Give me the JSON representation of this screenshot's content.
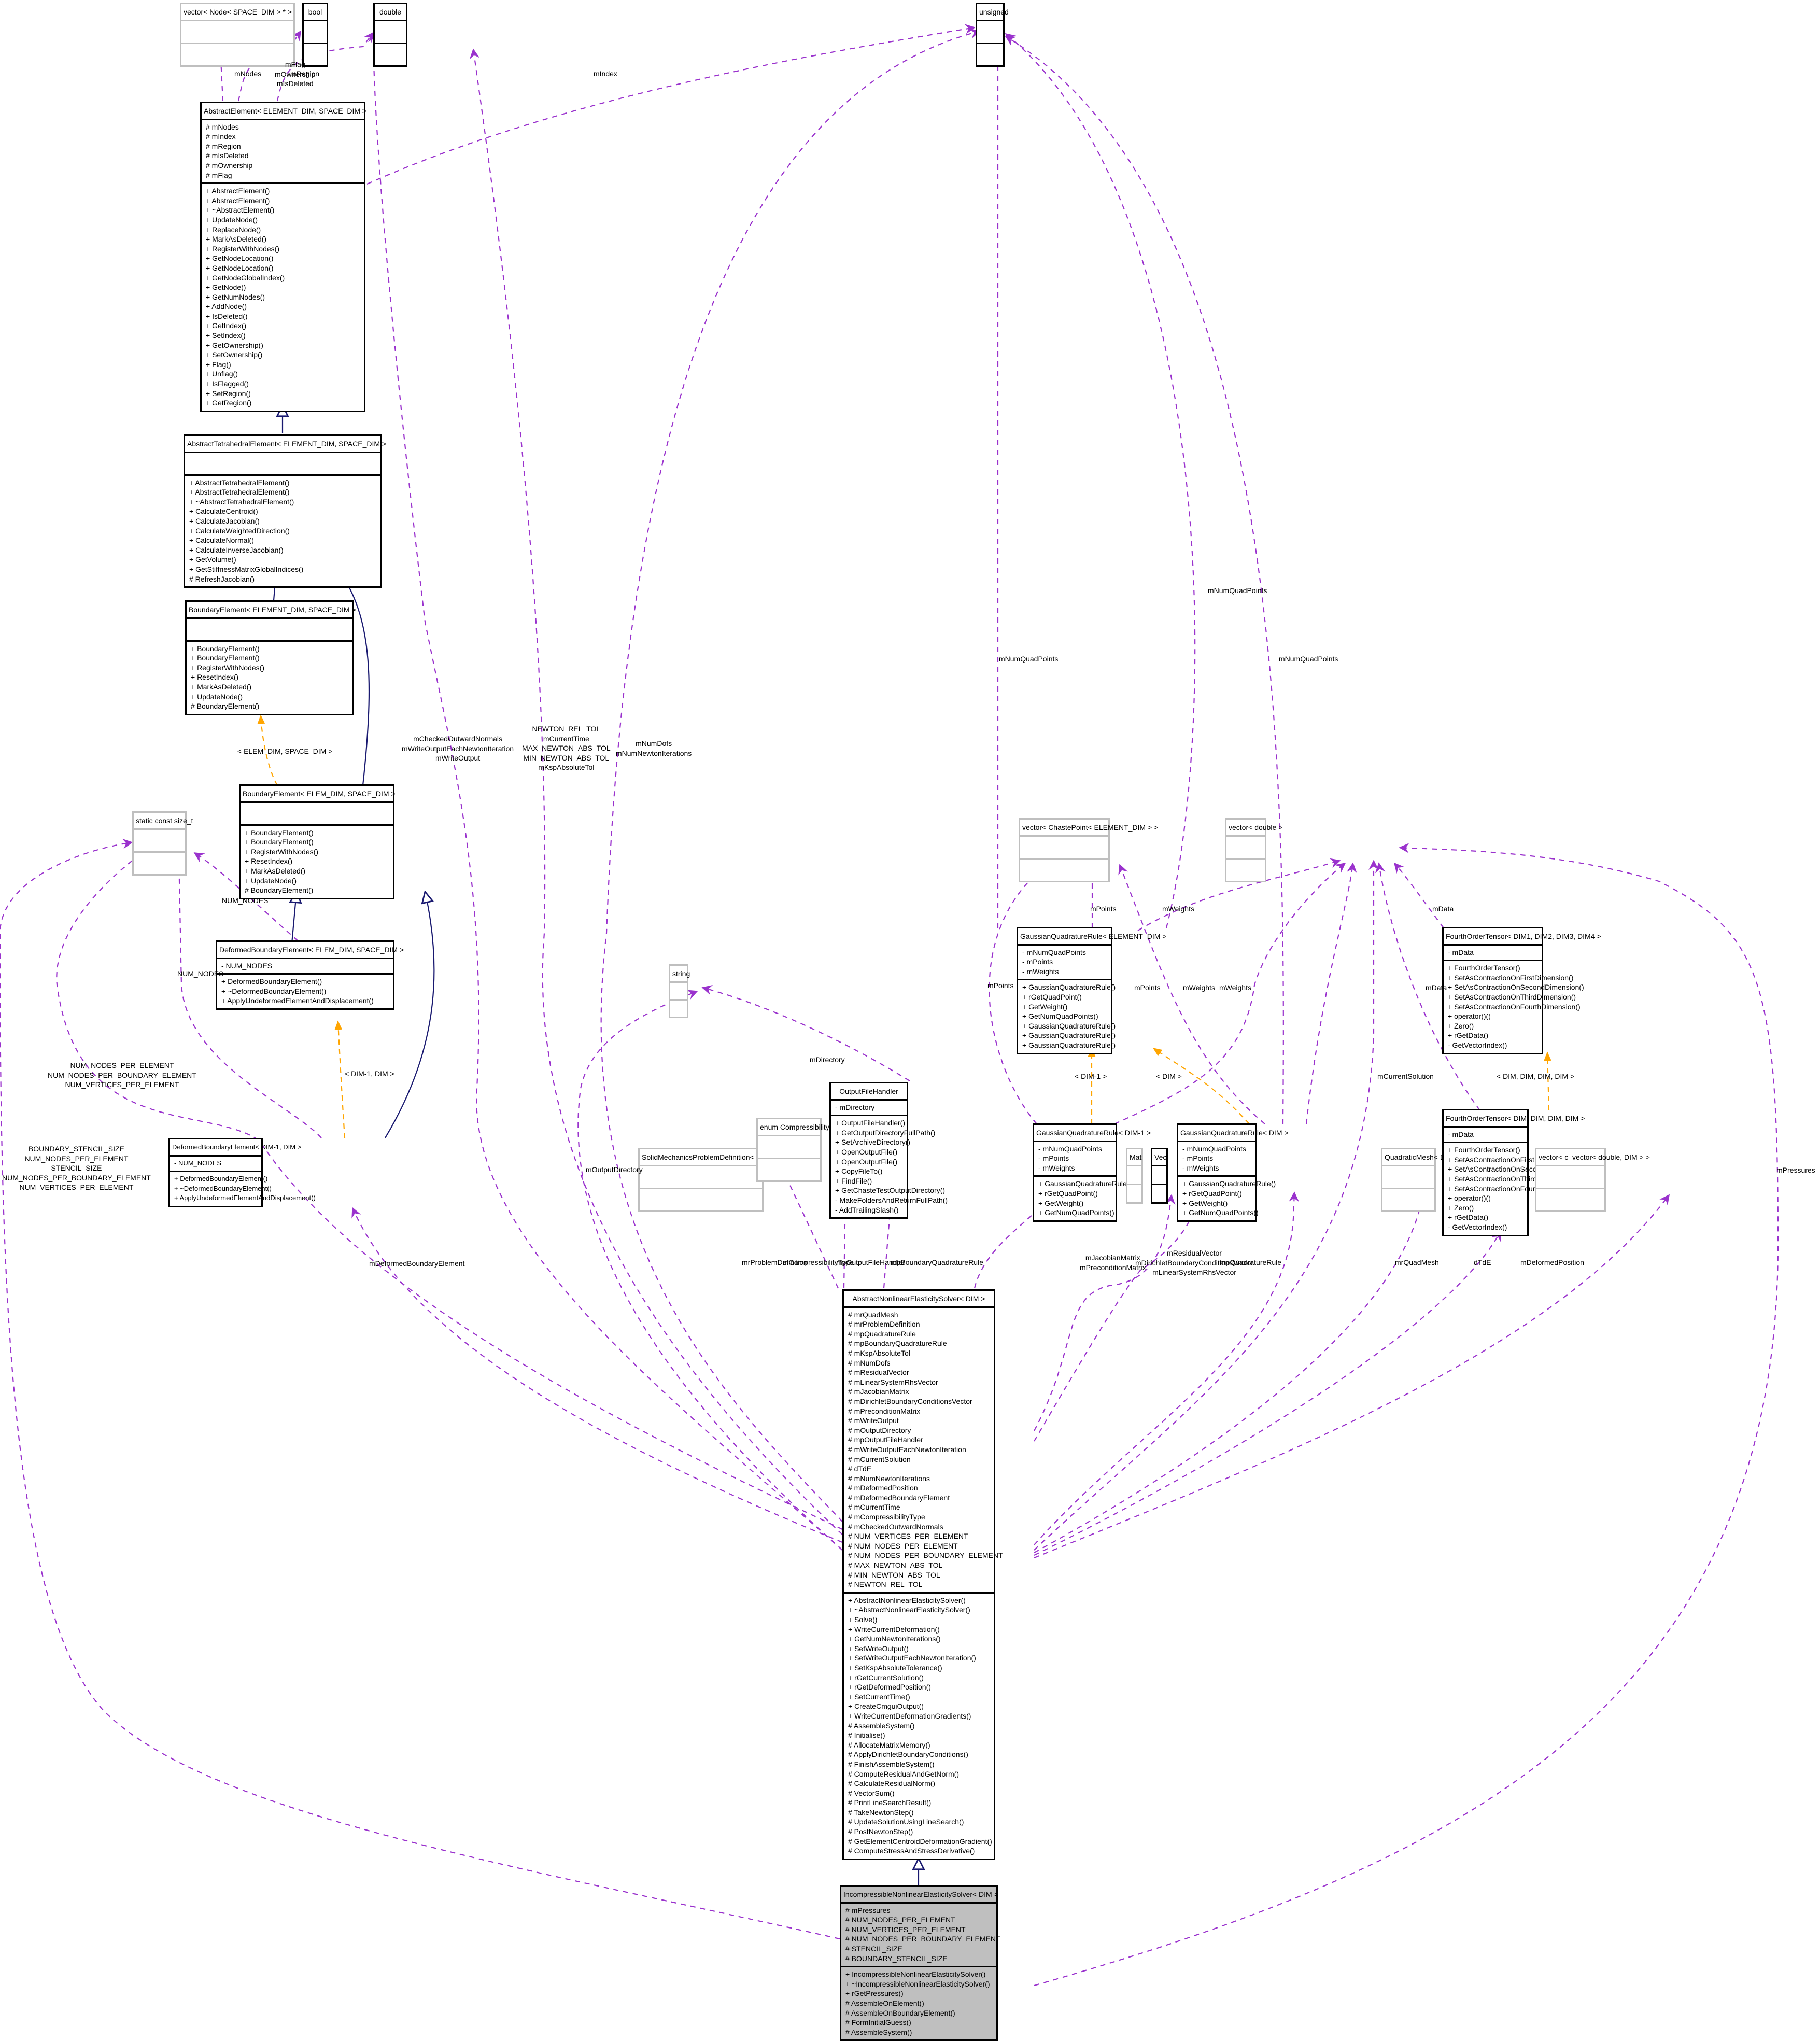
{
  "diagram": {
    "type": "uml-collaboration-graph",
    "focus_class": "IncompressibleNonlinearElasticitySolver< DIM >",
    "colors": {
      "association_edge": "#9a32cd",
      "inheritance_edge": "#191970",
      "template_edge": "#ffa500",
      "focus_fill": "#bfbfbf",
      "class_border": "#000000",
      "external_border": "#bfbfbf"
    }
  },
  "nodes": {
    "vector_node": {
      "title": "vector< Node< SPACE_DIM > * >",
      "attributes": [],
      "methods": []
    },
    "bool": {
      "title": "bool",
      "attributes": [],
      "methods": []
    },
    "double": {
      "title": "double",
      "attributes": [],
      "methods": []
    },
    "unsigned": {
      "title": "unsigned",
      "attributes": [],
      "methods": []
    },
    "abstract_element": {
      "title": "AbstractElement< ELEMENT_DIM, SPACE_DIM >",
      "attributes": [
        "# mNodes",
        "# mIndex",
        "# mRegion",
        "# mIsDeleted",
        "# mOwnership",
        "# mFlag"
      ],
      "methods": [
        "+ AbstractElement()",
        "+ AbstractElement()",
        "+ ~AbstractElement()",
        "+ UpdateNode()",
        "+ ReplaceNode()",
        "+ MarkAsDeleted()",
        "+ RegisterWithNodes()",
        "+ GetNodeLocation()",
        "+ GetNodeLocation()",
        "+ GetNodeGlobalIndex()",
        "+ GetNode()",
        "+ GetNumNodes()",
        "+ AddNode()",
        "+ IsDeleted()",
        "+ GetIndex()",
        "+ SetIndex()",
        "+ GetOwnership()",
        "+ SetOwnership()",
        "+ Flag()",
        "+ Unflag()",
        "+ IsFlagged()",
        "+ SetRegion()",
        "+ GetRegion()"
      ]
    },
    "abstract_tetrahedral_element": {
      "title": "AbstractTetrahedralElement< ELEMENT_DIM, SPACE_DIM >",
      "attributes": [],
      "methods": [
        "+ AbstractTetrahedralElement()",
        "+ AbstractTetrahedralElement()",
        "+ ~AbstractTetrahedralElement()",
        "+ CalculateCentroid()",
        "+ CalculateJacobian()",
        "+ CalculateWeightedDirection()",
        "+ CalculateNormal()",
        "+ CalculateInverseJacobian()",
        "+ GetVolume()",
        "+ GetStiffnessMatrixGlobalIndices()",
        "# RefreshJacobian()"
      ]
    },
    "boundary_element": {
      "title": "BoundaryElement< ELEMENT_DIM, SPACE_DIM >",
      "attributes": [],
      "methods": [
        "+ BoundaryElement()",
        "+ BoundaryElement()",
        "+ RegisterWithNodes()",
        "+ ResetIndex()",
        "+ MarkAsDeleted()",
        "+ UpdateNode()",
        "# BoundaryElement()"
      ]
    },
    "boundary_element_elem": {
      "title": "BoundaryElement< ELEM_DIM, SPACE_DIM >",
      "attributes": [],
      "methods": [
        "+ BoundaryElement()",
        "+ BoundaryElement()",
        "+ RegisterWithNodes()",
        "+ ResetIndex()",
        "+ MarkAsDeleted()",
        "+ UpdateNode()",
        "# BoundaryElement()"
      ]
    },
    "static_size_t": {
      "title": "static const size_t",
      "attributes": [],
      "methods": []
    },
    "deformed_boundary_element_elem": {
      "title": "DeformedBoundaryElement< ELEM_DIM, SPACE_DIM >",
      "attributes": [
        "- NUM_NODES"
      ],
      "methods": [
        "+ DeformedBoundaryElement()",
        "+ ~DeformedBoundaryElement()",
        "+ ApplyUndeformedElementAndDisplacement()"
      ]
    },
    "deformed_boundary_element_dim": {
      "title": "DeformedBoundaryElement< DIM-1, DIM >",
      "attributes": [
        "- NUM_NODES"
      ],
      "methods": [
        "+ DeformedBoundaryElement()",
        "+ ~DeformedBoundaryElement()",
        "+ ApplyUndeformedElementAndDisplacement()"
      ]
    },
    "string": {
      "title": "string",
      "attributes": [],
      "methods": []
    },
    "solid_mechanics_problem": {
      "title": "SolidMechanicsProblemDefinition< DIM > &",
      "attributes": [],
      "methods": []
    },
    "compressibility_enum": {
      "title": "enum CompressibilityType_",
      "attributes": [],
      "methods": []
    },
    "output_file_handler": {
      "title": "OutputFileHandler",
      "attributes": [
        "- mDirectory"
      ],
      "methods": [
        "+ OutputFileHandler()",
        "+ GetOutputDirectoryFullPath()",
        "+ SetArchiveDirectory()",
        "+ OpenOutputFile()",
        "+ OpenOutputFile()",
        "+ CopyFileTo()",
        "+ FindFile()",
        "+ GetChasteTestOutputDirectory()",
        "- MakeFoldersAndReturnFullPath()",
        "- AddTrailingSlash()"
      ]
    },
    "vector_chaste_point": {
      "title": "vector< ChastePoint< ELEMENT_DIM > >",
      "attributes": [],
      "methods": []
    },
    "gqr_element_dim": {
      "title": "GaussianQuadratureRule< ELEMENT_DIM >",
      "attributes": [
        "- mNumQuadPoints",
        "- mPoints",
        "- mWeights"
      ],
      "methods": [
        "+ GaussianQuadratureRule()",
        "+ rGetQuadPoint()",
        "+ GetWeight()",
        "+ GetNumQuadPoints()",
        "+ GaussianQuadratureRule()",
        "+ GaussianQuadratureRule()",
        "+ GaussianQuadratureRule()"
      ]
    },
    "gqr_dim_minus_1": {
      "title": "GaussianQuadratureRule< DIM-1 >",
      "attributes": [
        "- mNumQuadPoints",
        "- mPoints",
        "- mWeights"
      ],
      "methods": [
        "+ GaussianQuadratureRule()",
        "+ rGetQuadPoint()",
        "+ GetWeight()",
        "+ GetNumQuadPoints()"
      ]
    },
    "mat": {
      "title": "Mat",
      "attributes": [],
      "methods": []
    },
    "vec": {
      "title": "Vec",
      "attributes": [],
      "methods": []
    },
    "gqr_dim": {
      "title": "GaussianQuadratureRule< DIM >",
      "attributes": [
        "- mNumQuadPoints",
        "- mPoints",
        "- mWeights"
      ],
      "methods": [
        "+ GaussianQuadratureRule()",
        "+ rGetQuadPoint()",
        "+ GetWeight()",
        "+ GetNumQuadPoints()"
      ]
    },
    "vector_double": {
      "title": "vector< double >",
      "attributes": [],
      "methods": []
    },
    "fourth_order_tensor_generic": {
      "title": "FourthOrderTensor< DIM1, DIM2, DIM3, DIM4 >",
      "attributes": [
        "- mData"
      ],
      "methods": [
        "+ FourthOrderTensor()",
        "+ SetAsContractionOnFirstDimension()",
        "+ SetAsContractionOnSecondDimension()",
        "+ SetAsContractionOnThirdDimension()",
        "+ SetAsContractionOnFourthDimension()",
        "+ operator()()",
        "+ Zero()",
        "+ rGetData()",
        "- GetVectorIndex()"
      ]
    },
    "quadratic_mesh": {
      "title": "QuadraticMesh< DIM > &",
      "attributes": [],
      "methods": []
    },
    "fourth_order_tensor_dim": {
      "title": "FourthOrderTensor< DIM, DIM, DIM, DIM >",
      "attributes": [
        "- mData"
      ],
      "methods": [
        "+ FourthOrderTensor()",
        "+ SetAsContractionOnFirstDimension()",
        "+ SetAsContractionOnSecondDimension()",
        "+ SetAsContractionOnThirdDimension()",
        "+ SetAsContractionOnFourthDimension()",
        "+ operator()()",
        "+ Zero()",
        "+ rGetData()",
        "- GetVectorIndex()"
      ]
    },
    "vector_c_vector": {
      "title": "vector< c_vector< double, DIM > >",
      "attributes": [],
      "methods": []
    },
    "abstract_solver": {
      "title": "AbstractNonlinearElasticitySolver< DIM >",
      "attributes": [
        "# mrQuadMesh",
        "# mrProblemDefinition",
        "# mpQuadratureRule",
        "# mpBoundaryQuadratureRule",
        "# mKspAbsoluteTol",
        "# mNumDofs",
        "# mResidualVector",
        "# mLinearSystemRhsVector",
        "# mJacobianMatrix",
        "# mDirichletBoundaryConditionsVector",
        "# mPreconditionMatrix",
        "# mWriteOutput",
        "# mOutputDirectory",
        "# mpOutputFileHandler",
        "# mWriteOutputEachNewtonIteration",
        "# mCurrentSolution",
        "# dTdE",
        "# mNumNewtonIterations",
        "# mDeformedPosition",
        "# mDeformedBoundaryElement",
        "# mCurrentTime",
        "# mCompressibilityType",
        "# mCheckedOutwardNormals",
        "# NUM_VERTICES_PER_ELEMENT",
        "# NUM_NODES_PER_ELEMENT",
        "# NUM_NODES_PER_BOUNDARY_ELEMENT",
        "# MAX_NEWTON_ABS_TOL",
        "# MIN_NEWTON_ABS_TOL",
        "# NEWTON_REL_TOL"
      ],
      "methods": [
        "+ AbstractNonlinearElasticitySolver()",
        "+ ~AbstractNonlinearElasticitySolver()",
        "+ Solve()",
        "+ WriteCurrentDeformation()",
        "+ GetNumNewtonIterations()",
        "+ SetWriteOutput()",
        "+ SetWriteOutputEachNewtonIteration()",
        "+ SetKspAbsoluteTolerance()",
        "+ rGetCurrentSolution()",
        "+ rGetDeformedPosition()",
        "+ SetCurrentTime()",
        "+ CreateCmguiOutput()",
        "+ WriteCurrentDeformationGradients()",
        "# AssembleSystem()",
        "# Initialise()",
        "# AllocateMatrixMemory()",
        "# ApplyDirichletBoundaryConditions()",
        "# FinishAssembleSystem()",
        "# ComputeResidualAndGetNorm()",
        "# CalculateResidualNorm()",
        "# VectorSum()",
        "# PrintLineSearchResult()",
        "# TakeNewtonStep()",
        "# UpdateSolutionUsingLineSearch()",
        "# PostNewtonStep()",
        "# GetElementCentroidDeformationGradient()",
        "# ComputeStressAndStressDerivative()"
      ]
    },
    "incompressible_solver": {
      "title": "IncompressibleNonlinearElasticitySolver< DIM >",
      "attributes": [
        "# mPressures",
        "# NUM_NODES_PER_ELEMENT",
        "# NUM_VERTICES_PER_ELEMENT",
        "# NUM_NODES_PER_BOUNDARY_ELEMENT",
        "# STENCIL_SIZE",
        "# BOUNDARY_STENCIL_SIZE"
      ],
      "methods": [
        "+ IncompressibleNonlinearElasticitySolver()",
        "+ ~IncompressibleNonlinearElasticitySolver()",
        "+ rGetPressures()",
        "# AssembleOnElement()",
        "# AssembleOnBoundaryElement()",
        "# FormInitialGuess()",
        "# AssembleSystem()"
      ]
    }
  },
  "edge_labels": {
    "mNodes": "mNodes",
    "flag_ownership_deleted": [
      "mFlag",
      "mOwnership",
      "mIsDeleted"
    ],
    "mRegion": "mRegion",
    "mIndex": "mIndex",
    "elem_space_template": "< ELEM_DIM, SPACE_DIM >",
    "num_nodes_a": "NUM_NODES",
    "num_nodes_b": "NUM_NODES",
    "dim1_dim_template": "< DIM-1, DIM >",
    "abstract_to_sizet": [
      "NUM_NODES_PER_ELEMENT",
      "NUM_NODES_PER_BOUNDARY_ELEMENT",
      "NUM_VERTICES_PER_ELEMENT"
    ],
    "incompressible_to_sizet": [
      "BOUNDARY_STENCIL_SIZE",
      "NUM_NODES_PER_ELEMENT",
      "STENCIL_SIZE",
      "NUM_NODES_PER_BOUNDARY_ELEMENT",
      "NUM_VERTICES_PER_ELEMENT"
    ],
    "to_bool": [
      "mCheckedOutwardNormals",
      "mWriteOutputEachNewtonIteration",
      "mWriteOutput"
    ],
    "to_double": [
      "NEWTON_REL_TOL",
      "mCurrentTime",
      "MAX_NEWTON_ABS_TOL",
      "MIN_NEWTON_ABS_TOL",
      "mKspAbsoluteTol"
    ],
    "to_unsigned": [
      "mNumDofs",
      "mNumNewtonIterations"
    ],
    "mNumQuadPoints_a": "mNumQuadPoints",
    "mNumQuadPoints_b": "mNumQuadPoints",
    "mNumQuadPoints_c": "mNumQuadPoints",
    "mPoints_a": "mPoints",
    "mPoints_b": "mPoints",
    "mPoints_c": "mPoints",
    "mWeights_a": "mWeights",
    "mWeights_b": "mWeights",
    "mWeights_c": "mWeights",
    "mData_a": "mData",
    "mData_b": "mData",
    "dim1_template": "< DIM-1 >",
    "dim_template": "< DIM >",
    "dim4_template": "< DIM, DIM, DIM, DIM >",
    "mDirectory": "mDirectory",
    "mOutputDirectory": "mOutputDirectory",
    "mDeformedBoundaryElement": "mDeformedBoundaryElement",
    "mrProblemDefinition": "mrProblemDefinition",
    "mCompressibilityType": "mCompressibilityType",
    "mpOutputFileHandler": "mpOutputFileHandler",
    "mpBoundaryQuadratureRule": "mpBoundaryQuadratureRule",
    "to_mat": [
      "mJacobianMatrix",
      "mPreconditionMatrix"
    ],
    "to_vec": [
      "mResidualVector",
      "mDirichletBoundaryConditionsVector",
      "mLinearSystemRhsVector"
    ],
    "mpQuadratureRule": "mpQuadratureRule",
    "mCurrentSolution": "mCurrentSolution",
    "mrQuadMesh": "mrQuadMesh",
    "dTdE": "dTdE",
    "mDeformedPosition": "mDeformedPosition",
    "mPressures": "mPressures"
  }
}
